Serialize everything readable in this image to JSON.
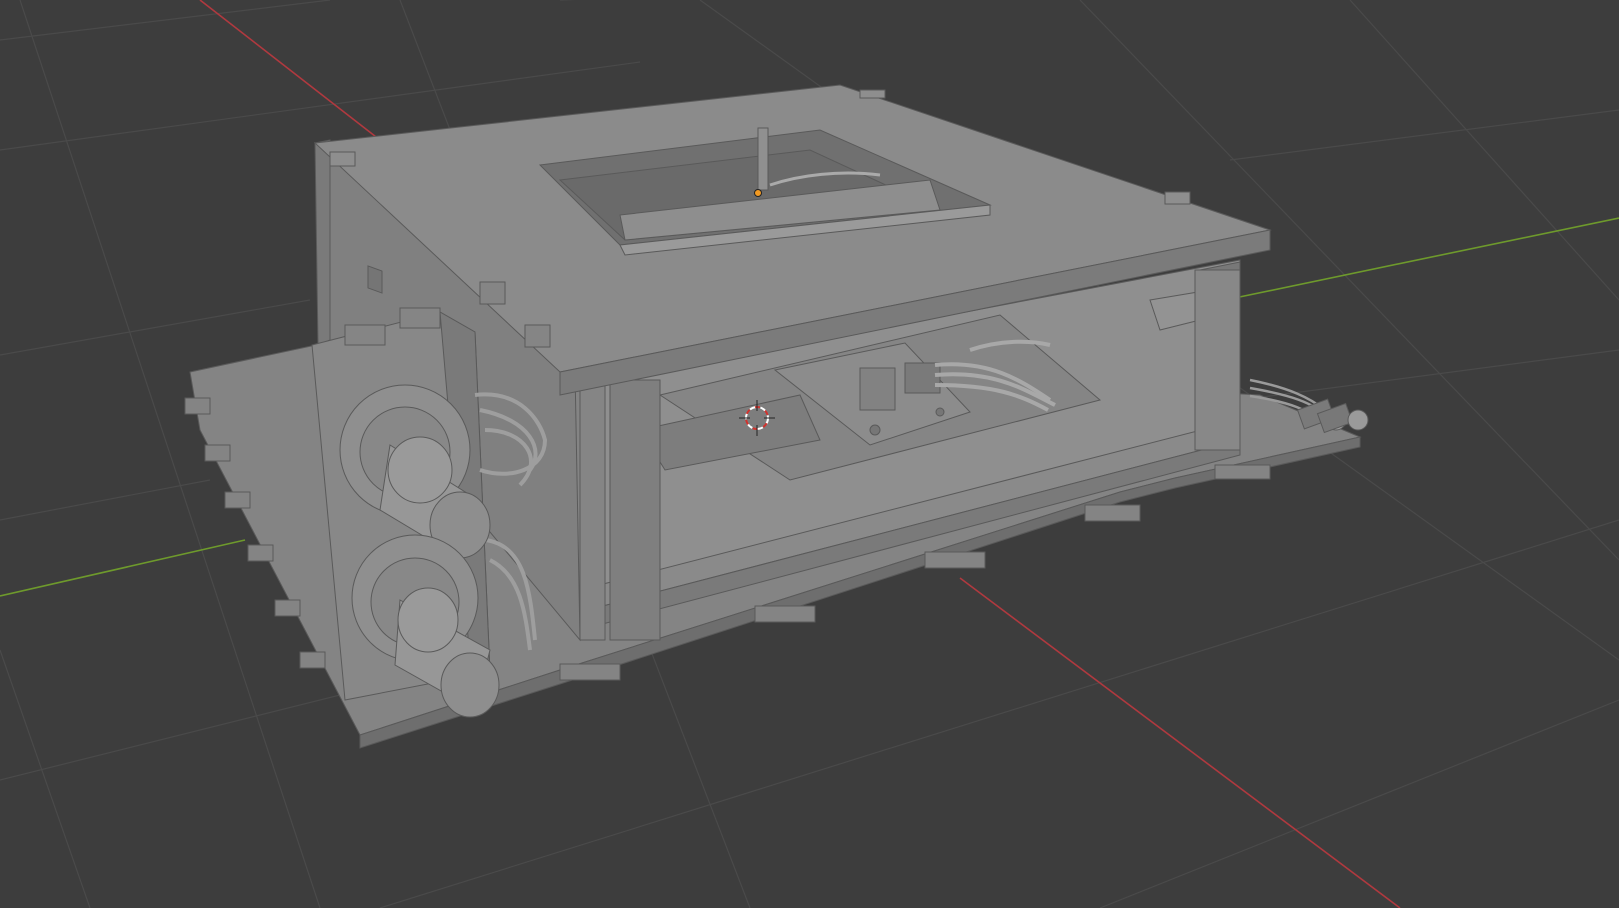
{
  "viewport": {
    "background": "#3d3d3d",
    "grid_color": "#4a4a4a",
    "x_axis_color": "#b0393f",
    "y_axis_color": "#6e9a2c"
  },
  "model": {
    "face_top": "#8b8b8b",
    "face_side": "#7f7f7f",
    "face_dark": "#6e6e6e",
    "edge_color": "#5a5a5a"
  },
  "cursor": {
    "icon": "3d-cursor-icon",
    "colors": [
      "#ffffff",
      "#d2322d"
    ]
  },
  "origin_marker": {
    "icon": "object-origin-icon",
    "color": "#f29a22"
  }
}
